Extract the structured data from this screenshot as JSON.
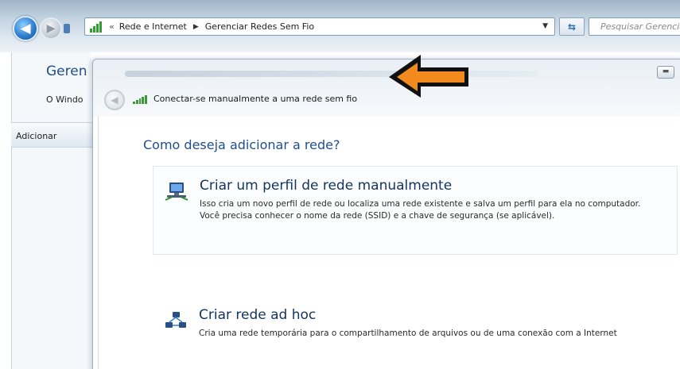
{
  "explorer": {
    "address_chevrons": "«",
    "breadcrumbs": [
      "Rede e Internet",
      "Gerenciar Redes Sem Fio"
    ],
    "search_placeholder": "Pesquisar Gerenciar Redes Sem Fio",
    "heading_partial": "Geren",
    "subtext_partial": "O Windo",
    "toolbar_button": "Adicionar"
  },
  "dialog": {
    "title": "Conectar-se manualmente a uma rede sem fio",
    "instruction": "Como deseja adicionar a rede?",
    "options": [
      {
        "title": "Criar um perfil de rede manualmente",
        "description": "Isso cria um novo perfil de rede ou localiza uma rede existente e salva um perfil para ela no computador. Você precisa conhecer o nome da rede (SSID) e a chave de segurança (se aplicável).",
        "icon": "network-computer-icon"
      },
      {
        "title": "Criar rede ad hoc",
        "description": "Cria uma rede temporária para o compartilhamento de arquivos ou de uma conexão com a Internet",
        "icon": "adhoc-network-icon"
      }
    ]
  },
  "colors": {
    "heading_blue": "#1e4f8c",
    "annotation_arrow": "#f28a1e"
  }
}
